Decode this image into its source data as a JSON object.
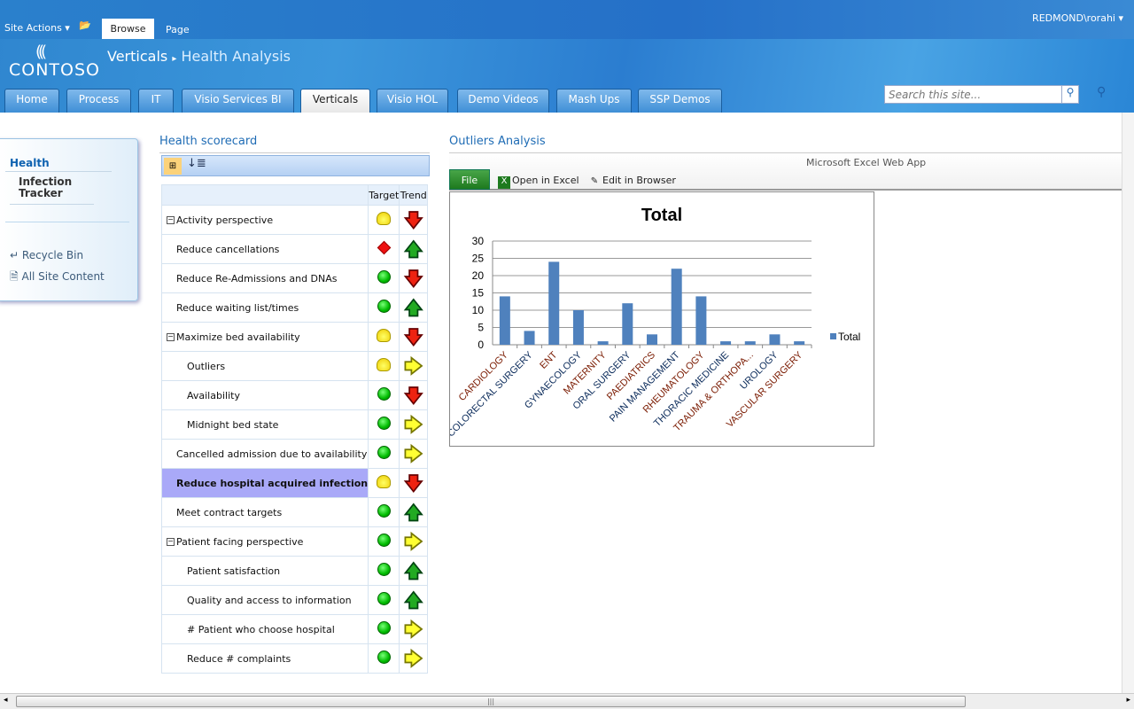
{
  "ribbon": {
    "site_actions": "Site Actions",
    "tabs": [
      "Browse",
      "Page"
    ],
    "user": "REDMOND\\rorahi"
  },
  "header": {
    "logo": "CONTOSO",
    "breadcrumb": [
      "Verticals",
      "Health Analysis"
    ]
  },
  "nav_tabs": [
    "Home",
    "Process",
    "IT",
    "Visio Services BI",
    "Verticals",
    "Visio HOL",
    "Demo Videos",
    "Mash Ups",
    "SSP Demos"
  ],
  "selected_tab": "Verticals",
  "search": {
    "placeholder": "Search this site..."
  },
  "leftnav": {
    "heading": "Health",
    "items": [
      "Infection Tracker"
    ],
    "recycle_bin": "Recycle Bin",
    "all_site_content": "All Site Content"
  },
  "scorecard": {
    "title": "Health scorecard",
    "columns": [
      "",
      "Target",
      "Trend"
    ],
    "rows": [
      {
        "label": "Activity perspective",
        "level": 1,
        "expand": true,
        "target": "yellow",
        "trend": "down"
      },
      {
        "label": "Reduce cancellations",
        "level": 1,
        "target": "red",
        "trend": "up"
      },
      {
        "label": "Reduce Re-Admissions and DNAs",
        "level": 1,
        "target": "green",
        "trend": "down"
      },
      {
        "label": "Reduce waiting list/times",
        "level": 1,
        "target": "green",
        "trend": "up"
      },
      {
        "label": "Maximize bed availability",
        "level": 1,
        "expand": true,
        "target": "yellow",
        "trend": "down"
      },
      {
        "label": "Outliers",
        "level": 2,
        "target": "yellow",
        "trend": "flat"
      },
      {
        "label": "Availability",
        "level": 2,
        "target": "green",
        "trend": "down"
      },
      {
        "label": "Midnight bed state",
        "level": 2,
        "target": "green",
        "trend": "flat"
      },
      {
        "label": "Cancelled admission due to availability",
        "level": 1,
        "target": "green",
        "trend": "flat"
      },
      {
        "label": "Reduce hospital acquired infection",
        "level": 1,
        "selected": true,
        "target": "yellow",
        "trend": "down"
      },
      {
        "label": "Meet contract targets",
        "level": 1,
        "target": "green",
        "trend": "up"
      },
      {
        "label": "Patient facing perspective",
        "level": 1,
        "expand": true,
        "target": "green",
        "trend": "flat"
      },
      {
        "label": "Patient satisfaction",
        "level": 2,
        "target": "green",
        "trend": "up"
      },
      {
        "label": "Quality and access to information",
        "level": 2,
        "target": "green",
        "trend": "up"
      },
      {
        "label": "# Patient who choose hospital",
        "level": 2,
        "target": "green",
        "trend": "flat"
      },
      {
        "label": "Reduce # complaints",
        "level": 2,
        "target": "green",
        "trend": "flat"
      }
    ]
  },
  "excel": {
    "title": "Outliers Analysis",
    "app": "Microsoft Excel Web App",
    "file": "File",
    "open": "Open in Excel",
    "edit": "Edit in Browser"
  },
  "chart_data": {
    "type": "bar",
    "title": "Total",
    "categories": [
      "CARDIOLOGY",
      "COLORECTAL SURGERY",
      "ENT",
      "GYNAECOLOGY",
      "MATERNITY",
      "ORAL SURGERY",
      "PAEDIATRICS",
      "PAIN MANAGEMENT",
      "RHEUMATOLOGY",
      "THORACIC MEDICINE",
      "TRAUMA & ORTHOPA...",
      "UROLOGY",
      "VASCULAR SURGERY"
    ],
    "series": [
      {
        "name": "Total",
        "values": [
          14,
          4,
          24,
          10,
          1,
          12,
          3,
          22,
          14,
          1,
          1,
          3,
          1
        ]
      }
    ],
    "ylim": [
      0,
      30
    ],
    "yticks": [
      0,
      5,
      10,
      15,
      20,
      25,
      30
    ],
    "grid": true,
    "legend": "right",
    "color": "#4f81bd"
  }
}
